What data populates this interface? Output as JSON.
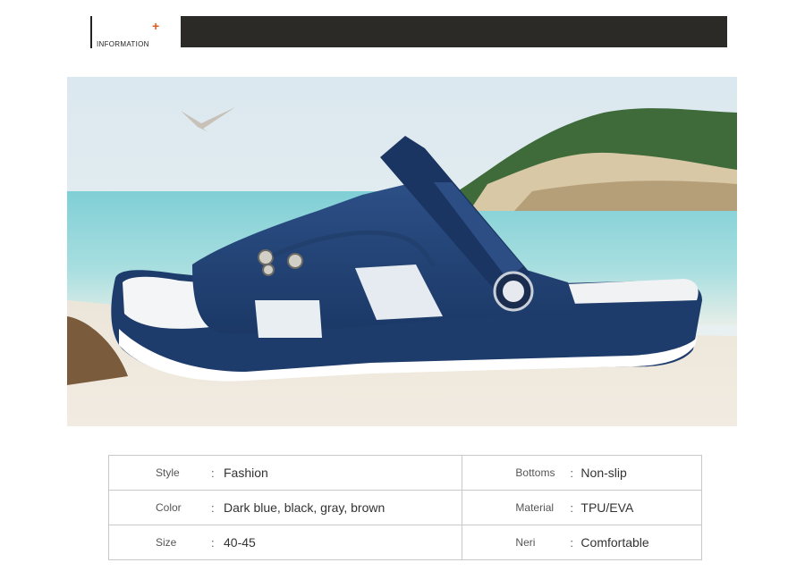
{
  "header": {
    "label": "INFORMATION",
    "plus": "+"
  },
  "photo": {
    "alt": "Dark blue slipper on beach"
  },
  "specs": [
    {
      "key": "Style",
      "value": "Fashion",
      "key2": "Bottoms",
      "value2": "Non-slip"
    },
    {
      "key": "Color",
      "value": "Dark blue, black, gray, brown",
      "key2": "Material",
      "value2": "TPU/EVA"
    },
    {
      "key": "Size",
      "value": "40-45",
      "key2": "Neri",
      "value2": "Comfortable"
    }
  ],
  "colon": ":"
}
